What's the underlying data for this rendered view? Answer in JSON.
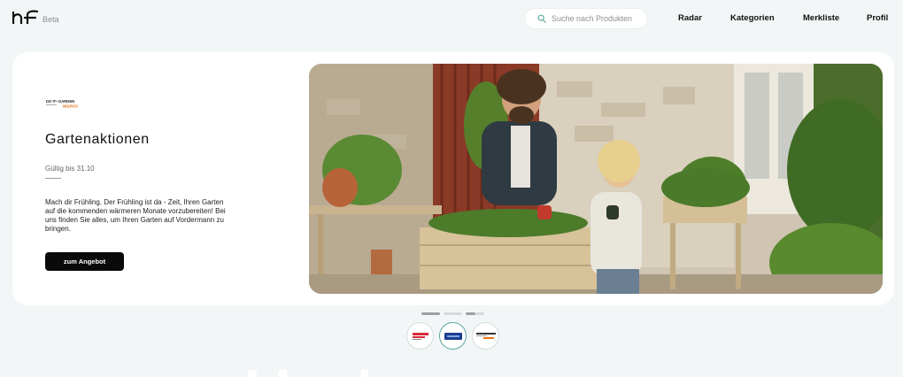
{
  "header": {
    "logo_text": "HF",
    "beta_label": "Beta",
    "search": {
      "placeholder": "Suche nach Produkten",
      "icon": "search-icon"
    },
    "nav": [
      {
        "label": "Radar"
      },
      {
        "label": "Kategorien"
      },
      {
        "label": "Merkliste"
      },
      {
        "label": "Profil"
      }
    ]
  },
  "hero": {
    "brand_logo_text": "DO IT + GARDEN MIGROS",
    "title": "Gartenaktionen",
    "valid_until": "Gültig bis 31.10",
    "description": "Mach dir Frühling. Der Frühling ist da - Zeit, Ihren Garten auf die kommenden wärmeren Monate vorzubereiten! Bei uns finden Sie alles, um Ihren Garten auf Vordermann zu bringen.",
    "cta_label": "zum Angebot",
    "image_subject": "garden-planting-photo"
  },
  "carousel": {
    "indicators": [
      {
        "active": true
      },
      {
        "active": false
      },
      {
        "active": false
      }
    ],
    "thumbnails": [
      {
        "brand": "brand-logo-red",
        "active": false
      },
      {
        "brand": "brand-logo-blue",
        "active": true
      },
      {
        "brand": "brand-logo-doit-garden",
        "active": false
      }
    ]
  },
  "colors": {
    "background": "#f2f6f7",
    "card": "#ffffff",
    "cta": "#0a0a0a",
    "accent": "#5aa9a4"
  }
}
